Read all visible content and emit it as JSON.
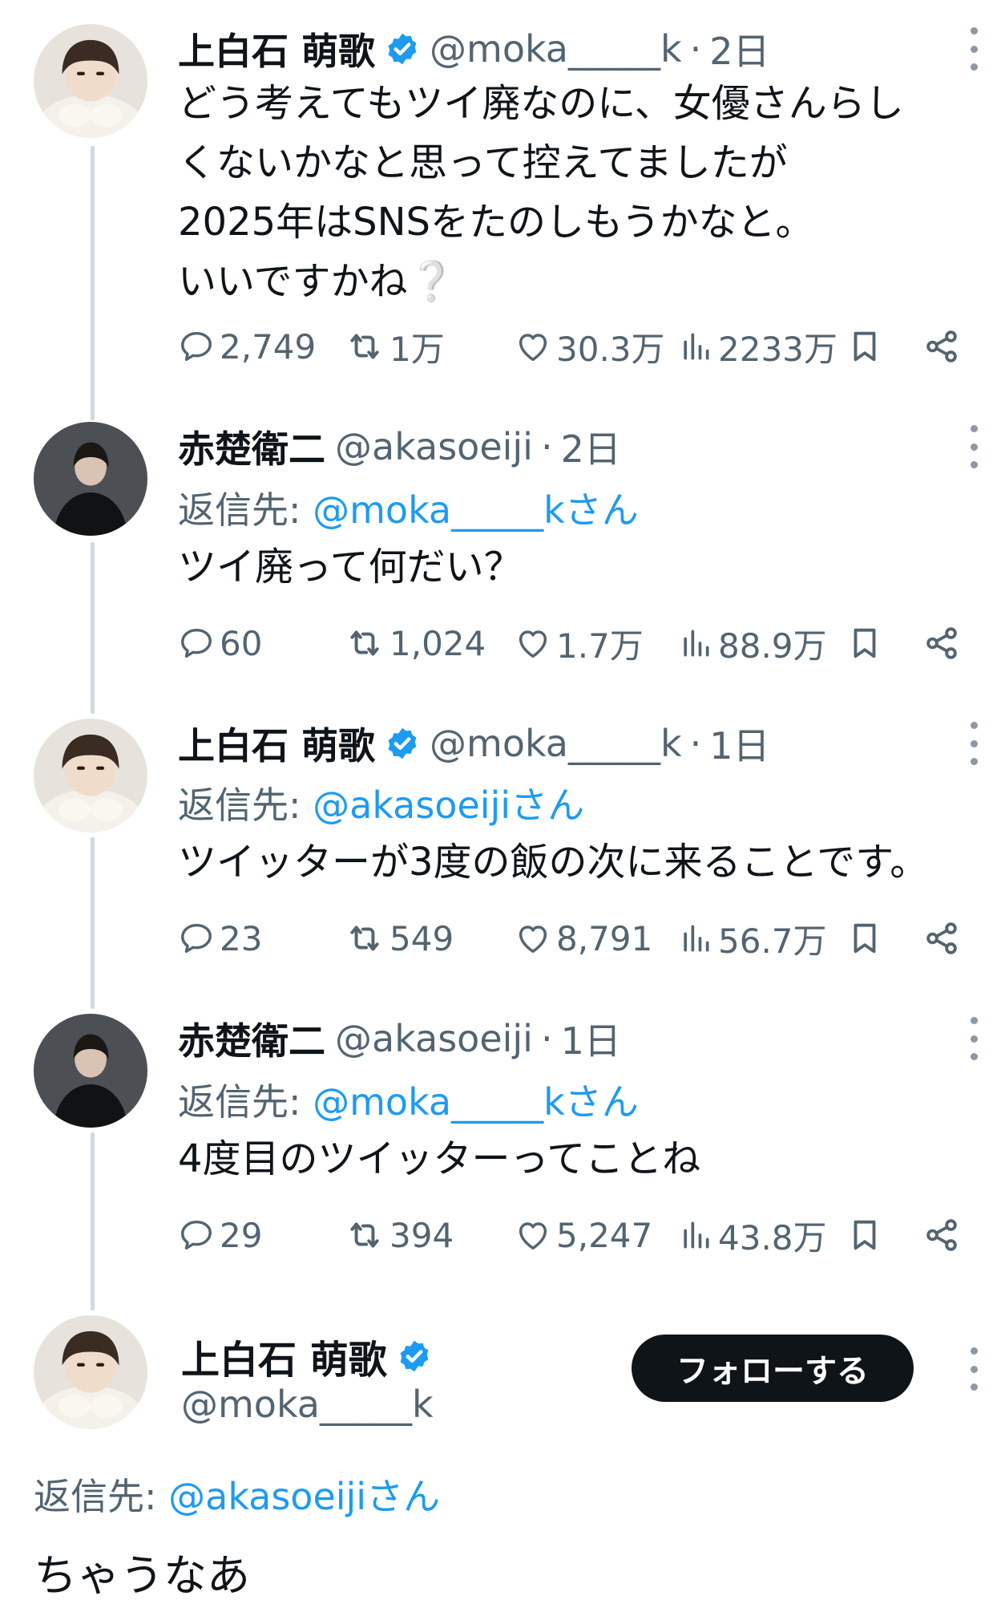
{
  "colors": {
    "link": "#1d9bf0",
    "muted": "#536471",
    "verified": "#1d9bf0",
    "button": "#0f1419"
  },
  "users": {
    "moka": {
      "name": "上白石 萌歌",
      "handle": "@moka_____k",
      "verified": true
    },
    "akaso": {
      "name": "赤楚衛二",
      "handle": "@akasoeiji",
      "verified": false
    }
  },
  "tweets": [
    {
      "name": "上白石 萌歌",
      "handle": "@moka_____k",
      "time": "2日",
      "text": "どう考えてもツイ廃なのに、女優さんらし\nくないかなと思って控えてましたが\n2025年はSNSをたのしもうかなと。\nいいですかね❔",
      "stats": {
        "replies": "2,749",
        "retweets": "1万",
        "likes": "30.3万",
        "views": "2233万"
      }
    },
    {
      "name": "赤楚衛二",
      "handle": "@akasoeiji",
      "time": "2日",
      "reply_label": "返信先: ",
      "reply_mention": "@moka_____kさん",
      "text": "ツイ廃って何だい？",
      "stats": {
        "replies": "60",
        "retweets": "1,024",
        "likes": "1.7万",
        "views": "88.9万"
      }
    },
    {
      "name": "上白石 萌歌",
      "handle": "@moka_____k",
      "time": "1日",
      "reply_label": "返信先: ",
      "reply_mention": "@akasoeijiさん",
      "text": "ツイッターが3度の飯の次に来ることです。",
      "stats": {
        "replies": "23",
        "retweets": "549",
        "likes": "8,791",
        "views": "56.7万"
      }
    },
    {
      "name": "赤楚衛二",
      "handle": "@akasoeiji",
      "time": "1日",
      "reply_label": "返信先: ",
      "reply_mention": "@moka_____kさん",
      "text": "4度目のツイッターってことね",
      "stats": {
        "replies": "29",
        "retweets": "394",
        "likes": "5,247",
        "views": "43.8万"
      }
    }
  ],
  "focused": {
    "name": "上白石 萌歌",
    "handle": "@moka_____k",
    "follow_label": "フォローする",
    "reply_label": "返信先: ",
    "reply_mention": "@akasoeijiさん",
    "text": "ちゃうなあ"
  },
  "icons": [
    "reply-icon",
    "retweet-icon",
    "like-icon",
    "views-icon",
    "bookmark-icon",
    "share-icon",
    "verified-badge-icon",
    "more-icon"
  ]
}
